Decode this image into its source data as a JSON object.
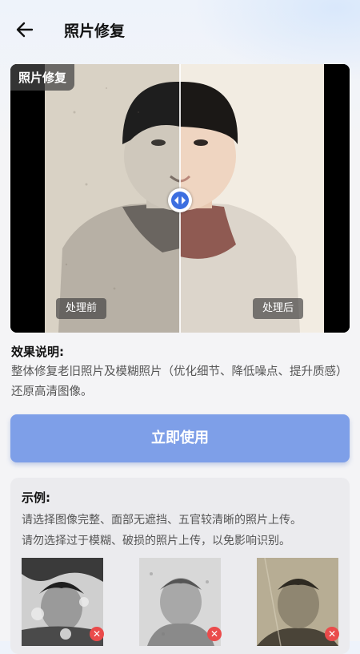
{
  "header": {
    "title": "照片修复"
  },
  "compare": {
    "corner_tag": "照片修复",
    "before_label": "处理前",
    "after_label": "处理后"
  },
  "description": {
    "title": "效果说明:",
    "text": "整体修复老旧照片及模糊照片（优化细节、降低噪点、提升质感）还原高清图像。"
  },
  "action": {
    "use_label": "立即使用"
  },
  "examples": {
    "title": "示例:",
    "line1": "请选择图像完整、面部无遮挡、五官较清晰的照片上传。",
    "line2": "请勿选择过于模糊、破损的照片上传，以免影响识别。"
  },
  "colors": {
    "accent": "#7e9fe8",
    "error": "#ea4b4b"
  }
}
